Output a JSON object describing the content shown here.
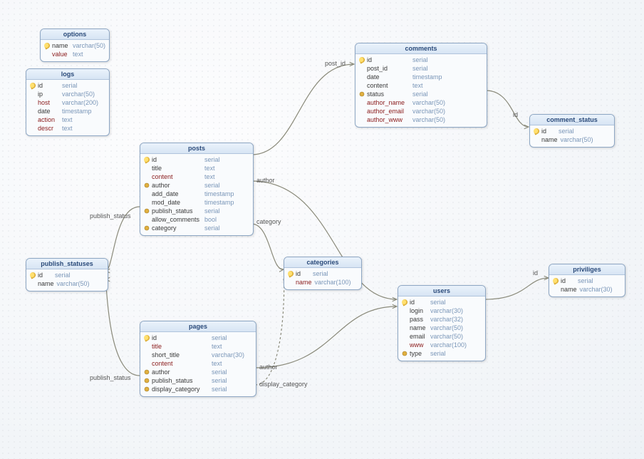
{
  "tables": {
    "options": {
      "title": "options",
      "cols": [
        {
          "icon": "key",
          "name": "name",
          "type": "varchar(50)",
          "req": false
        },
        {
          "icon": "",
          "name": "value",
          "type": "text",
          "req": true
        }
      ]
    },
    "logs": {
      "title": "logs",
      "cols": [
        {
          "icon": "key",
          "name": "id",
          "type": "serial",
          "req": false
        },
        {
          "icon": "",
          "name": "ip",
          "type": "varchar(50)",
          "req": false
        },
        {
          "icon": "",
          "name": "host",
          "type": "varchar(200)",
          "req": true
        },
        {
          "icon": "",
          "name": "date",
          "type": "timestamp",
          "req": false
        },
        {
          "icon": "",
          "name": "action",
          "type": "text",
          "req": true
        },
        {
          "icon": "",
          "name": "descr",
          "type": "text",
          "req": true
        }
      ]
    },
    "posts": {
      "title": "posts",
      "cols": [
        {
          "icon": "key",
          "name": "id",
          "type": "serial",
          "req": false
        },
        {
          "icon": "",
          "name": "title",
          "type": "text",
          "req": false
        },
        {
          "icon": "",
          "name": "content",
          "type": "text",
          "req": true
        },
        {
          "icon": "ref",
          "name": "author",
          "type": "serial",
          "req": false
        },
        {
          "icon": "",
          "name": "add_date",
          "type": "timestamp",
          "req": false
        },
        {
          "icon": "",
          "name": "mod_date",
          "type": "timestamp",
          "req": false
        },
        {
          "icon": "ref",
          "name": "publish_status",
          "type": "serial",
          "req": false
        },
        {
          "icon": "",
          "name": "allow_comments",
          "type": "bool",
          "req": false
        },
        {
          "icon": "ref",
          "name": "category",
          "type": "serial",
          "req": false
        }
      ]
    },
    "comments": {
      "title": "comments",
      "cols": [
        {
          "icon": "key",
          "name": "id",
          "type": "serial",
          "req": false
        },
        {
          "icon": "",
          "name": "post_id",
          "type": "serial",
          "req": false
        },
        {
          "icon": "",
          "name": "date",
          "type": "timestamp",
          "req": false
        },
        {
          "icon": "",
          "name": "content",
          "type": "text",
          "req": false
        },
        {
          "icon": "ref",
          "name": "status",
          "type": "serial",
          "req": false
        },
        {
          "icon": "",
          "name": "author_name",
          "type": "varchar(50)",
          "req": true
        },
        {
          "icon": "",
          "name": "author_email",
          "type": "varchar(50)",
          "req": true
        },
        {
          "icon": "",
          "name": "author_www",
          "type": "varchar(50)",
          "req": true
        }
      ]
    },
    "comment_status": {
      "title": "comment_status",
      "cols": [
        {
          "icon": "key",
          "name": "id",
          "type": "serial",
          "req": false
        },
        {
          "icon": "",
          "name": "name",
          "type": "varchar(50)",
          "req": false
        }
      ]
    },
    "publish_statuses": {
      "title": "publish_statuses",
      "cols": [
        {
          "icon": "key",
          "name": "id",
          "type": "serial",
          "req": false
        },
        {
          "icon": "",
          "name": "name",
          "type": "varchar(50)",
          "req": false
        }
      ]
    },
    "categories": {
      "title": "categories",
      "cols": [
        {
          "icon": "key",
          "name": "id",
          "type": "serial",
          "req": false
        },
        {
          "icon": "",
          "name": "name",
          "type": "varchar(100)",
          "req": true
        }
      ]
    },
    "users": {
      "title": "users",
      "cols": [
        {
          "icon": "key",
          "name": "id",
          "type": "serial",
          "req": false
        },
        {
          "icon": "",
          "name": "login",
          "type": "varchar(30)",
          "req": false
        },
        {
          "icon": "",
          "name": "pass",
          "type": "varchar(32)",
          "req": false
        },
        {
          "icon": "",
          "name": "name",
          "type": "varchar(50)",
          "req": false
        },
        {
          "icon": "",
          "name": "email",
          "type": "varchar(50)",
          "req": false
        },
        {
          "icon": "",
          "name": "www",
          "type": "varchar(100)",
          "req": true
        },
        {
          "icon": "ref",
          "name": "type",
          "type": "serial",
          "req": false
        }
      ]
    },
    "priviliges": {
      "title": "priviliges",
      "cols": [
        {
          "icon": "key",
          "name": "id",
          "type": "serial",
          "req": false
        },
        {
          "icon": "",
          "name": "name",
          "type": "varchar(30)",
          "req": false
        }
      ]
    },
    "pages": {
      "title": "pages",
      "cols": [
        {
          "icon": "key",
          "name": "id",
          "type": "serial",
          "req": false
        },
        {
          "icon": "",
          "name": "title",
          "type": "text",
          "req": true
        },
        {
          "icon": "",
          "name": "short_title",
          "type": "varchar(30)",
          "req": false
        },
        {
          "icon": "",
          "name": "content",
          "type": "text",
          "req": true
        },
        {
          "icon": "ref",
          "name": "author",
          "type": "serial",
          "req": false
        },
        {
          "icon": "ref",
          "name": "publish_status",
          "type": "serial",
          "req": false
        },
        {
          "icon": "ref",
          "name": "display_category",
          "type": "serial",
          "req": false
        }
      ]
    }
  },
  "labels": {
    "post_id": "post_id",
    "id1": "id",
    "author1": "author",
    "category": "category",
    "publish_status1": "publish_status",
    "publish_status2": "publish_status",
    "author2": "author",
    "display_category": "display_category",
    "id2": "id"
  },
  "connections": [
    {
      "from": "posts",
      "fromField": "id",
      "to": "comments",
      "toField": "post_id",
      "label": "post_id"
    },
    {
      "from": "comments",
      "fromField": "status",
      "to": "comment_status",
      "toField": "id",
      "label": "id"
    },
    {
      "from": "posts",
      "fromField": "author",
      "to": "users",
      "toField": "id",
      "label": "author"
    },
    {
      "from": "posts",
      "fromField": "category",
      "to": "categories",
      "toField": "id",
      "label": "category"
    },
    {
      "from": "posts",
      "fromField": "publish_status",
      "to": "publish_statuses",
      "toField": "id",
      "label": "publish_status"
    },
    {
      "from": "pages",
      "fromField": "publish_status",
      "to": "publish_statuses",
      "toField": "id",
      "label": "publish_status"
    },
    {
      "from": "pages",
      "fromField": "author",
      "to": "users",
      "toField": "id",
      "label": "author"
    },
    {
      "from": "pages",
      "fromField": "display_category",
      "to": "categories",
      "toField": "id",
      "label": "display_category"
    },
    {
      "from": "users",
      "fromField": "type",
      "to": "priviliges",
      "toField": "id",
      "label": "id"
    }
  ]
}
